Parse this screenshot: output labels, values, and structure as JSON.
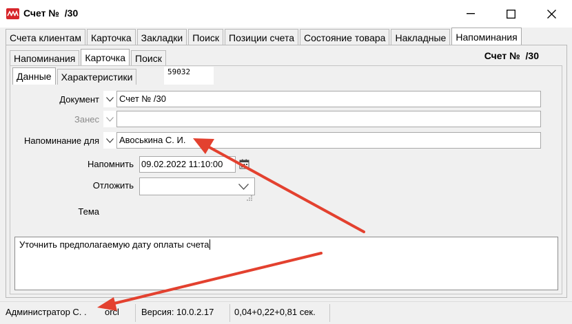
{
  "window": {
    "title": "Счет №  /30",
    "logo_icon": "app-logo-icon",
    "controls": [
      "minimize-icon",
      "maximize-icon",
      "close-icon"
    ]
  },
  "main_tabs": [
    {
      "label": "Счета клиентам",
      "active": false
    },
    {
      "label": "Карточка",
      "active": false
    },
    {
      "label": "Закладки",
      "active": false
    },
    {
      "label": "Поиск",
      "active": false
    },
    {
      "label": "Позиции счета",
      "active": false
    },
    {
      "label": "Состояние товара",
      "active": false
    },
    {
      "label": "Накладные",
      "active": false
    },
    {
      "label": "Напоминания",
      "active": true
    }
  ],
  "sub_tabs": [
    {
      "label": "Напоминания",
      "active": false
    },
    {
      "label": "Карточка",
      "active": true
    },
    {
      "label": "Поиск",
      "active": false
    }
  ],
  "inner_tabs": [
    {
      "label": "Данные",
      "active": true
    },
    {
      "label": "Характеристики",
      "active": false
    }
  ],
  "header": {
    "doc_title": "Счет №  /30",
    "doc_id": "59032"
  },
  "form": {
    "document": {
      "label": "Документ",
      "value": "Счет №  /30"
    },
    "entered": {
      "label": "Занес",
      "value": ""
    },
    "remind_for": {
      "label": "Напоминание для",
      "value": "Авоськина С. И."
    },
    "remind_at": {
      "label": "Напомнить",
      "value": "09.02.2022 11:10:00"
    },
    "postpone": {
      "label": "Отложить",
      "value": ""
    },
    "subject": {
      "label": "Тема"
    },
    "memo": "Уточнить предполагаемую дату оплаты счета"
  },
  "statusbar": {
    "user": "Администратор С. .",
    "db": "orcl",
    "version": "Версия: 10.0.2.17",
    "timing": "0,04+0,22+0,81 сек."
  },
  "colors": {
    "annotation_arrow": "#e3412f",
    "logo": "#d7262b"
  }
}
